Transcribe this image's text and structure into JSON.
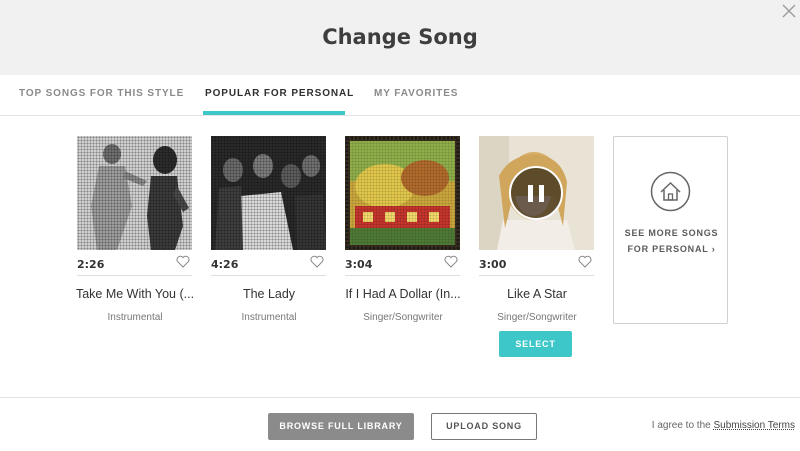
{
  "modal": {
    "title": "Change Song"
  },
  "tabs": [
    {
      "label": "TOP SONGS FOR THIS STYLE",
      "active": false
    },
    {
      "label": "POPULAR FOR PERSONAL",
      "active": true
    },
    {
      "label": "MY FAVORITES",
      "active": false
    }
  ],
  "songs": [
    {
      "duration": "2:26",
      "title": "Take Me With You (...",
      "genre": "Instrumental",
      "art": "two-dancers-photo"
    },
    {
      "duration": "4:26",
      "title": "The Lady",
      "genre": "Instrumental",
      "art": "band-group-photo"
    },
    {
      "duration": "3:04",
      "title": "If I Had A Dollar (In...",
      "genre": "Singer/Songwriter",
      "art": "illustrated-album-cover"
    },
    {
      "duration": "3:00",
      "title": "Like A Star",
      "genre": "Singer/Songwriter",
      "art": "woman-portrait-photo",
      "playing": true,
      "select_label": "SELECT"
    }
  ],
  "see_more": {
    "line1": "SEE MORE SONGS",
    "line2": "FOR PERSONAL ›",
    "icon": "home-icon"
  },
  "footer": {
    "browse_label": "BROWSE FULL LIBRARY",
    "upload_label": "UPLOAD SONG",
    "agree_text": "I agree to the ",
    "terms_link": "Submission Terms"
  },
  "colors": {
    "accent": "#3ec7c9",
    "header_bg": "#f1f1f1",
    "browse_bg": "#8b8b8b"
  }
}
